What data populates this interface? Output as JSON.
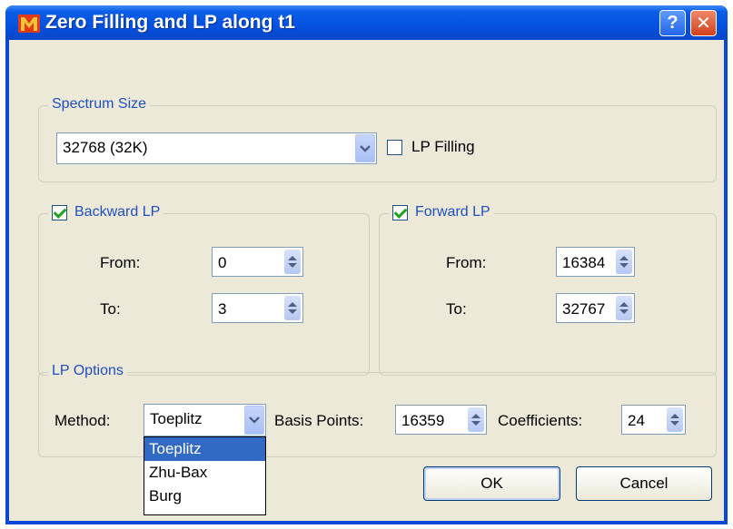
{
  "window": {
    "title": "Zero Filling and LP along t1",
    "help_label": "?",
    "close_label": "✕",
    "icon": "app-logo-icon",
    "title_color": "#0b5de8"
  },
  "spectrum_size": {
    "legend": "Spectrum Size",
    "selected": "32768 (32K)",
    "lp_filling_label": "LP Filling",
    "lp_filling_checked": false
  },
  "backward_lp": {
    "label": "Backward LP",
    "checked": true,
    "from_label": "From:",
    "from_value": "0",
    "to_label": "To:",
    "to_value": "3"
  },
  "forward_lp": {
    "label": "Forward LP",
    "checked": true,
    "from_label": "From:",
    "from_value": "16384",
    "to_label": "To:",
    "to_value": "32767"
  },
  "lp_options": {
    "legend": "LP Options",
    "method_label": "Method:",
    "method_value": "Toeplitz",
    "method_options": [
      "Toeplitz",
      "Zhu-Bax",
      "Burg"
    ],
    "basis_label": "Basis Points:",
    "basis_value": "16359",
    "coeff_label": "Coefficients:",
    "coeff_value": "24"
  },
  "buttons": {
    "ok": "OK",
    "cancel": "Cancel"
  }
}
